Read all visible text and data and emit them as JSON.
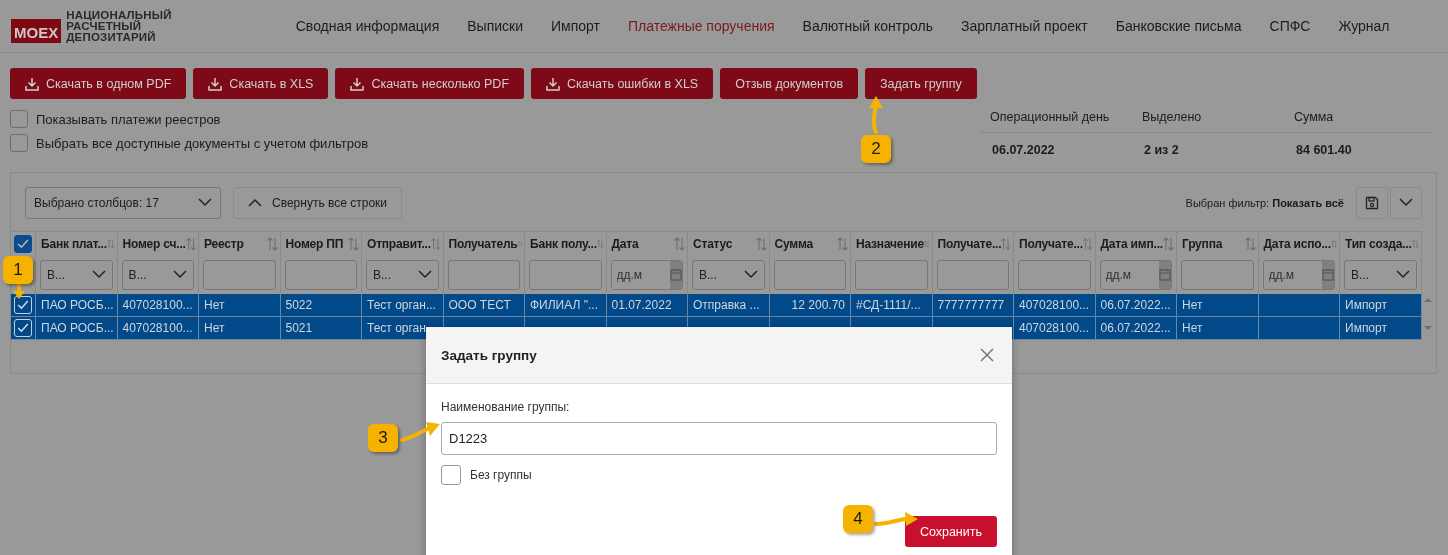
{
  "header": {
    "logo": {
      "mark": "MOEX",
      "lines": [
        "НАЦИОНАЛЬНЫЙ",
        "РАСЧЕТНЫЙ",
        "ДЕПОЗИТАРИЙ"
      ]
    },
    "nav": [
      {
        "label": "Сводная информация",
        "selected": false
      },
      {
        "label": "Выписки",
        "selected": false
      },
      {
        "label": "Импорт",
        "selected": false
      },
      {
        "label": "Платежные поручения",
        "selected": true
      },
      {
        "label": "Валютный контроль",
        "selected": false
      },
      {
        "label": "Зарплатный проект",
        "selected": false
      },
      {
        "label": "Банковские письма",
        "selected": false
      },
      {
        "label": "СПФС",
        "selected": false
      },
      {
        "label": "Журнал",
        "selected": false
      }
    ]
  },
  "toolbar": {
    "buttons": [
      {
        "label": "Скачать в одном PDF",
        "kind": "download"
      },
      {
        "label": "Скачать в XLS",
        "kind": "download"
      },
      {
        "label": "Скачать несколько PDF",
        "kind": "download"
      },
      {
        "label": "Скачать ошибки в XLS",
        "kind": "download"
      },
      {
        "label": "Отзыв документов",
        "kind": "plain"
      },
      {
        "label": "Задать группу",
        "kind": "plain"
      }
    ]
  },
  "options": [
    {
      "label": "Показывать платежи реестров",
      "checked": false
    },
    {
      "label": "Выбрать все доступные документы с учетом фильтров",
      "checked": false
    }
  ],
  "summary": [
    {
      "label": "Операционный день",
      "value": "06.07.2022"
    },
    {
      "label": "Выделено",
      "value": "2 из 2"
    },
    {
      "label": "Сумма",
      "value": "84 601.40"
    }
  ],
  "table": {
    "column_picker": "Выбрано столбцов: 17",
    "collapse_button": "Свернуть все строки",
    "filter_note": "Выбран фильтр: **Показать всё**",
    "all_checked": true,
    "columns": [
      {
        "label": "Банк плат...",
        "kind": "select",
        "value": "В..."
      },
      {
        "label": "Номер сч...",
        "kind": "select",
        "value": "В..."
      },
      {
        "label": "Реестр",
        "kind": "text"
      },
      {
        "label": "Номер ПП",
        "kind": "text"
      },
      {
        "label": "Отправит...",
        "kind": "select",
        "value": "В..."
      },
      {
        "label": "Получатель",
        "kind": "text"
      },
      {
        "label": "Банк полу...",
        "kind": "text"
      },
      {
        "label": "Дата",
        "kind": "date",
        "placeholder": "дд.м"
      },
      {
        "label": "Статус",
        "kind": "select",
        "value": "В..."
      },
      {
        "label": "Сумма",
        "kind": "text"
      },
      {
        "label": "Назначение",
        "kind": "text"
      },
      {
        "label": "Получате...",
        "kind": "text"
      },
      {
        "label": "Получате...",
        "kind": "text"
      },
      {
        "label": "Дата имп...",
        "kind": "date",
        "placeholder": "дд.м"
      },
      {
        "label": "Группа",
        "kind": "text"
      },
      {
        "label": "Дата испо...",
        "kind": "date",
        "placeholder": "дд.м"
      },
      {
        "label": "Тип созда...",
        "kind": "select",
        "value": "В..."
      }
    ],
    "rows": [
      {
        "selected": true,
        "cells": [
          "ПАО РОСБ...",
          "407028100...",
          "Нет",
          "5022",
          "Тест орган...",
          "ООО ТЕСТ",
          "ФИЛИАЛ \"...",
          "01.07.2022",
          "Отправка ...",
          "12 200.70",
          "#СД-1111/...",
          "7777777777",
          "407028100...",
          "06.07.2022...",
          "Нет",
          null,
          "Импорт"
        ]
      },
      {
        "selected": true,
        "cells": [
          "ПАО РОСБ...",
          "407028100...",
          "Нет",
          "5021",
          "Тест орган",
          null,
          null,
          null,
          null,
          null,
          null,
          null,
          "407028100...",
          "06.07.2022...",
          "Нет",
          null,
          "Импорт"
        ]
      }
    ]
  },
  "dialog": {
    "title": "Задать группу",
    "field_label": "Наименование группы:",
    "field_value": "D1223",
    "no_group": {
      "label": "Без группы",
      "checked": false
    },
    "save_button": "Сохранить"
  },
  "callouts": [
    "1",
    "2",
    "3",
    "4"
  ]
}
